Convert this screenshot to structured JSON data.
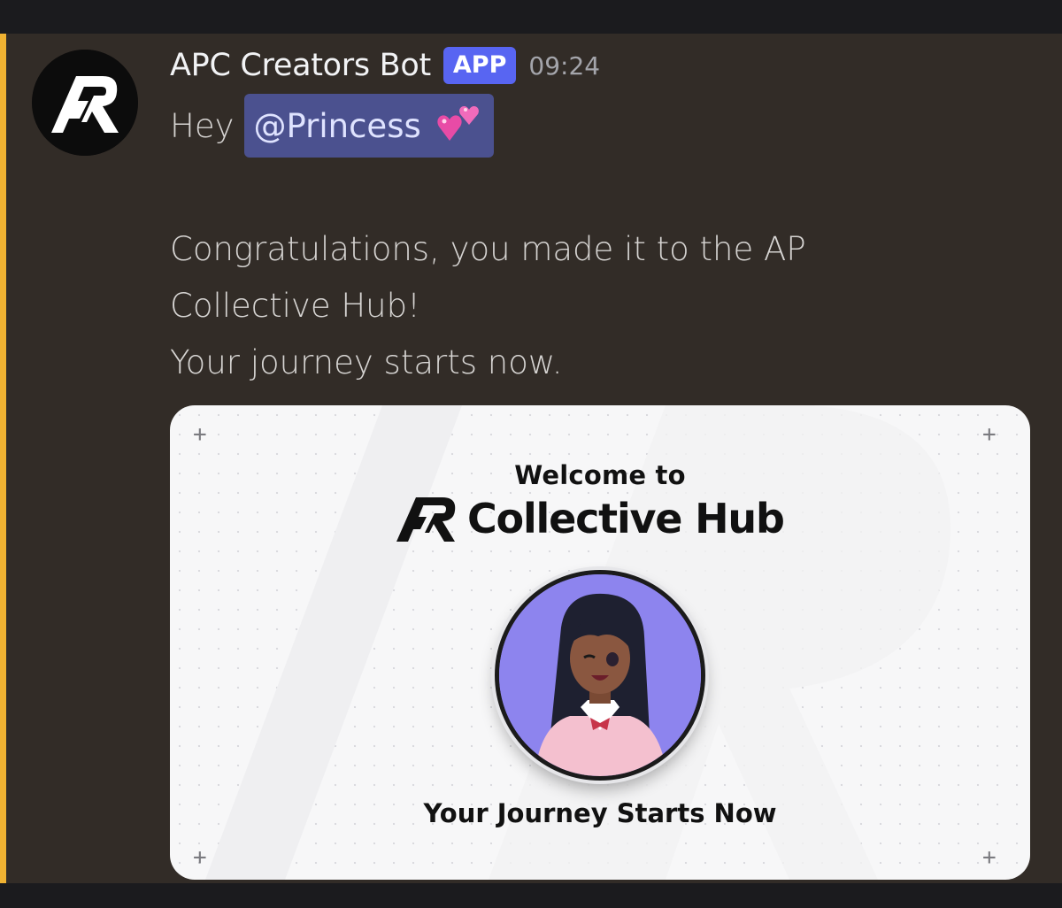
{
  "message": {
    "author": "APC Creators Bot",
    "badge": "APP",
    "timestamp": "09:24",
    "greeting": "Hey",
    "mention": "@Princess",
    "mention_emoji": "two-hearts",
    "body_lines": [
      "Congratulations, you made it to the AP",
      "Collective Hub!",
      "Your journey starts now."
    ]
  },
  "embed": {
    "welcome": "Welcome to",
    "title": "Collective Hub",
    "tagline": "Your Journey Starts Now"
  },
  "colors": {
    "message_bg": "#322c27",
    "highlight": "#f0b232",
    "badge": "#5865f2",
    "mention_bg": "#4b518f",
    "portrait_bg": "#8d84ee"
  },
  "icons": [
    "ap-logo-icon",
    "two-hearts-icon",
    "plus-corner-icon",
    "character-portrait"
  ]
}
